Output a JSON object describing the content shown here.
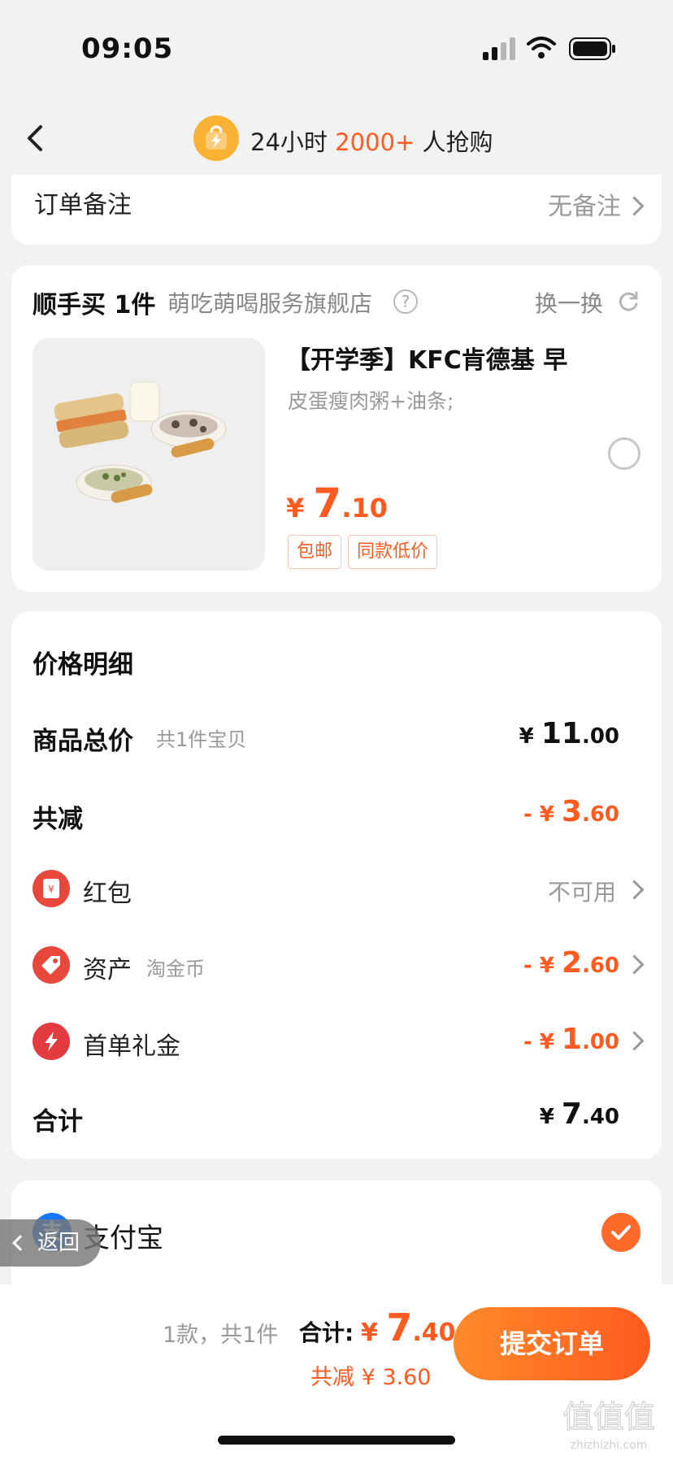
{
  "status_bar": {
    "time": "09:05"
  },
  "header": {
    "title_prefix": "24小时 ",
    "title_highlight": "2000+",
    "title_suffix": " 人抢购"
  },
  "order_note": {
    "label": "订单备注",
    "value": "无备注"
  },
  "add_on": {
    "title": "顺手买 1件",
    "store": "萌吃萌喝服务旗舰店",
    "help_glyph": "?",
    "swap_label": "换一换",
    "product": {
      "name": "【开学季】KFC肯德基 早",
      "spec": "皮蛋瘦肉粥+油条;",
      "price_currency": "¥ ",
      "price_int": "7",
      "price_dec": ".10",
      "tags": [
        "包邮",
        "同款低价"
      ],
      "selected": false
    }
  },
  "price_detail": {
    "heading": "价格明细",
    "goods_total": {
      "label": "商品总价",
      "sub": "共1件宝贝",
      "currency": "¥ ",
      "int": "11",
      "dec": ".00"
    },
    "discount_total": {
      "label": "共减",
      "currency": "- ¥ ",
      "int": "3",
      "dec": ".60"
    },
    "red_packet": {
      "icon": "red-packet-icon",
      "label": "红包",
      "value": "不可用"
    },
    "assets": {
      "icon": "tag-icon",
      "label": "资产",
      "sub": "淘金币",
      "currency": "- ¥ ",
      "int": "2",
      "dec": ".60"
    },
    "first_order": {
      "icon": "lightning-icon",
      "label": "首单礼金",
      "currency": "- ¥ ",
      "int": "1",
      "dec": ".00"
    },
    "total": {
      "label": "合计",
      "currency": "¥ ",
      "int": "7",
      "dec": ".40"
    }
  },
  "payment": {
    "method": "支付宝",
    "icon_glyph": "支",
    "selected": true
  },
  "return_pill": {
    "label": "返回"
  },
  "bottom_bar": {
    "count_text": "1款，共1件",
    "total_label": "合计:",
    "total_currency": " ¥ ",
    "total_int": "7",
    "total_dec": ".40",
    "saving_text": "共减 ¥ 3.60",
    "submit_label": "提交订单"
  },
  "watermark": {
    "text": "值值值",
    "domain": "zhizhizhi.com"
  },
  "colors": {
    "accent": "#ff5a1f",
    "alipay": "#1677ff",
    "badge": "#f9b233"
  }
}
